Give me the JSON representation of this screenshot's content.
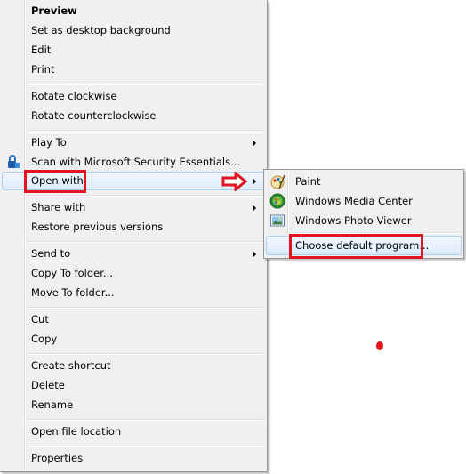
{
  "menu": {
    "items": [
      {
        "label": "Preview"
      },
      {
        "label": "Set as desktop background"
      },
      {
        "label": "Edit"
      },
      {
        "label": "Print"
      },
      {
        "label": "Rotate clockwise"
      },
      {
        "label": "Rotate counterclockwise"
      },
      {
        "label": "Play To"
      },
      {
        "label": "Scan with Microsoft Security Essentials..."
      },
      {
        "label": "Open with"
      },
      {
        "label": "Share with"
      },
      {
        "label": "Restore previous versions"
      },
      {
        "label": "Send to"
      },
      {
        "label": "Copy To folder..."
      },
      {
        "label": "Move To folder..."
      },
      {
        "label": "Cut"
      },
      {
        "label": "Copy"
      },
      {
        "label": "Create shortcut"
      },
      {
        "label": "Delete"
      },
      {
        "label": "Rename"
      },
      {
        "label": "Open file location"
      },
      {
        "label": "Properties"
      }
    ]
  },
  "submenu": {
    "items": [
      {
        "label": "Paint",
        "icon": "paint-icon"
      },
      {
        "label": "Windows Media Center",
        "icon": "windows-media-center-icon"
      },
      {
        "label": "Windows Photo Viewer",
        "icon": "windows-photo-viewer-icon"
      },
      {
        "label": "Choose default program..."
      }
    ]
  },
  "colors": {
    "menu_bg": "#f0f0f0",
    "hover_border": "#a8d0f7",
    "annotation_red": "#e1141f"
  }
}
